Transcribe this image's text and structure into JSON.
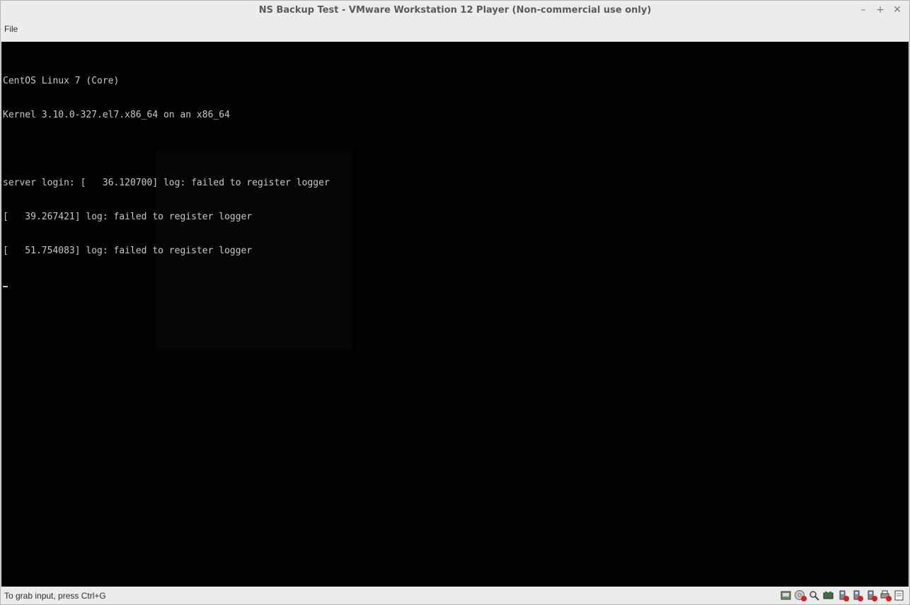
{
  "window": {
    "title": "NS Backup Test - VMware Workstation 12 Player (Non-commercial use only)",
    "controls": {
      "minimize": "–",
      "maximize": "+",
      "close": "✕"
    }
  },
  "menubar": {
    "file_label": "File"
  },
  "console": {
    "lines": [
      "CentOS Linux 7 (Core)",
      "Kernel 3.10.0-327.el7.x86_64 on an x86_64",
      "",
      "server login: [   36.120700] log: failed to register logger",
      "[   39.267421] log: failed to register logger",
      "[   51.754083] log: failed to register logger"
    ]
  },
  "statusbar": {
    "hint": "To grab input, press Ctrl+G",
    "devices": [
      {
        "icon": "hard-disk-icon",
        "disconnected": false
      },
      {
        "icon": "cd-dvd-icon",
        "disconnected": true
      },
      {
        "icon": "floppy-icon",
        "disconnected": false
      },
      {
        "icon": "network-adapter-icon",
        "disconnected": false
      },
      {
        "icon": "usb-device-icon",
        "disconnected": true
      },
      {
        "icon": "usb-device-icon",
        "disconnected": true
      },
      {
        "icon": "usb-device-icon",
        "disconnected": true
      },
      {
        "icon": "printer-icon",
        "disconnected": true
      },
      {
        "icon": "message-log-icon",
        "disconnected": false
      }
    ]
  },
  "colors": {
    "console_bg": "#000000",
    "console_fg": "#c8c8c8",
    "chrome_bg": "#ececec",
    "disconnected_badge": "#d32020"
  }
}
